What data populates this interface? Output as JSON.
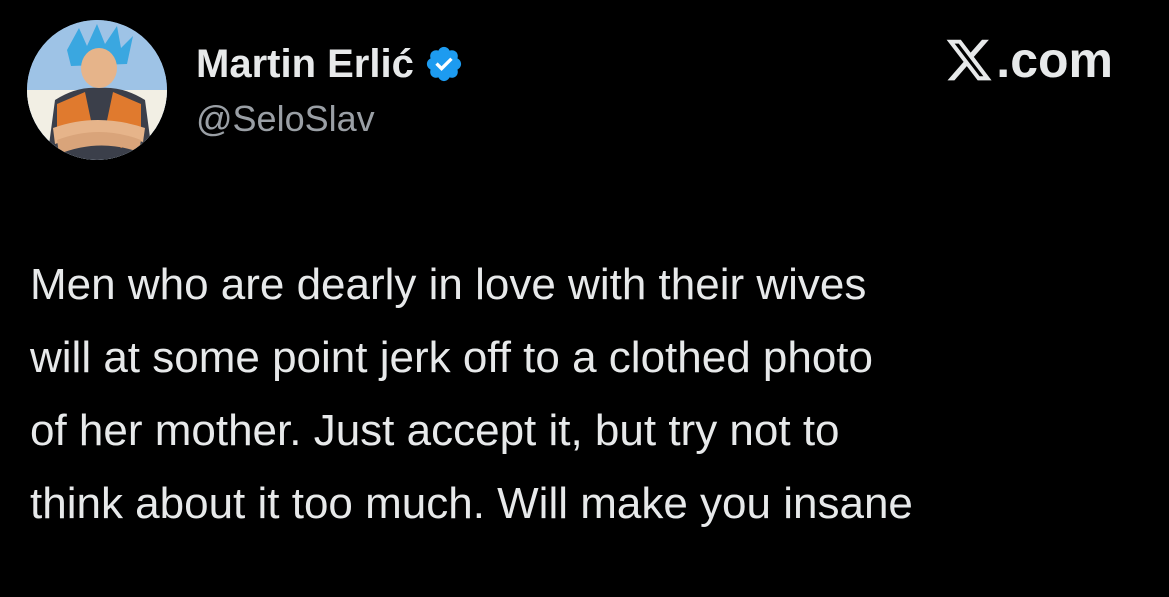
{
  "author": {
    "display_name": "Martin Erlić",
    "handle": "@SeloSlav",
    "verified_icon": "verified-badge-icon",
    "avatar_icon": "profile-avatar-anime-character"
  },
  "brand": {
    "logo_icon": "x-logo-icon",
    "suffix": ".com"
  },
  "tweet": {
    "text": "Men who are dearly in love with their wives\nwill at some point jerk off to a clothed photo\nof her mother. Just accept it, but try not to\nthink about it too much. Will make you insane"
  },
  "colors": {
    "background": "#000000",
    "text_primary": "#e7e9ea",
    "text_secondary": "#9a9fa5",
    "verified_blue": "#1d9bf0"
  }
}
